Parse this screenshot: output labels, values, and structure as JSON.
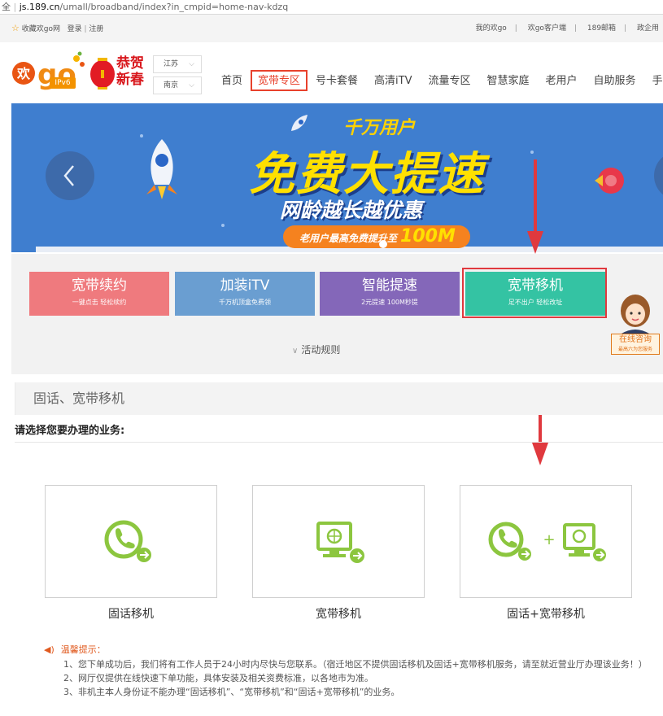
{
  "browser": {
    "prefix": "全",
    "url_host": "js.189.cn",
    "url_path": "/umall/broadband/index?in_cmpid=home-nav-kdzq"
  },
  "topbar": {
    "favorite": "收藏欢go网",
    "login": "登录",
    "register": "注册",
    "right_links": [
      "我的欢go",
      "欢go客户端",
      "189邮箱",
      "政企用"
    ]
  },
  "header": {
    "logo_text": "欢go",
    "logo_badge": "IPv6",
    "festival_text": [
      "恭贺",
      "新春"
    ],
    "province": "江苏",
    "city": "南京",
    "nav": [
      {
        "label": "首页",
        "active": false
      },
      {
        "label": "宽带专区",
        "active": true
      },
      {
        "label": "号卡套餐",
        "active": false
      },
      {
        "label": "高清iTV",
        "active": false
      },
      {
        "label": "流量专区",
        "active": false
      },
      {
        "label": "智慧家庭",
        "active": false
      },
      {
        "label": "老用户",
        "active": false
      },
      {
        "label": "自助服务",
        "active": false
      },
      {
        "label": "手机数码",
        "active": false
      }
    ]
  },
  "banner": {
    "top_line": "千万用户",
    "headline": "免费大提速",
    "line2": "网龄越长越优惠",
    "pill_text": "老用户最高免费提升至",
    "pill_big": "100M"
  },
  "activities": {
    "tiles": [
      {
        "title": "宽带续约",
        "subtitle": "一键点击 轻松续约",
        "color": "#ef7a7e"
      },
      {
        "title": "加装iTV",
        "subtitle": "千万机顶盒免费领",
        "color": "#6a9ed1"
      },
      {
        "title": "智能提速",
        "subtitle": "2元提速 100M秒提",
        "color": "#8467b9"
      },
      {
        "title": "宽带移机",
        "subtitle": "足不出户 轻松改址",
        "color": "#34c3a3"
      }
    ],
    "rules_label": "活动规则"
  },
  "consult": {
    "title": "在线咨询",
    "subtitle": "最高六为您服务"
  },
  "section": {
    "title": "固话、宽带移机",
    "prompt": "请选择您要办理的业务:"
  },
  "services": [
    {
      "label": "固话移机",
      "icon": "phone-move-icon"
    },
    {
      "label": "宽带移机",
      "icon": "computer-move-icon"
    },
    {
      "label": "固话+宽带移机",
      "icon": "phone-plus-computer-move-icon"
    }
  ],
  "tips": {
    "heading": "温馨提示：",
    "lines": [
      "1、您下单成功后，我们将有工作人员于24小时内尽快与您联系。（宿迁地区不提供固话移机及固话+宽带移机服务，请至就近营业厅办理该业务！）",
      "2、网厅仅提供在线快速下单功能，具体安装及相关资费标准，以各地市为准。",
      "3、非机主本人身份证不能办理“固话移机”、“宽带移机”和“固话+宽带移机”的业务。"
    ]
  },
  "colors": {
    "accent_red": "#e8412c",
    "icon_green": "#8cc63f",
    "annotation_red": "#e0393e"
  }
}
